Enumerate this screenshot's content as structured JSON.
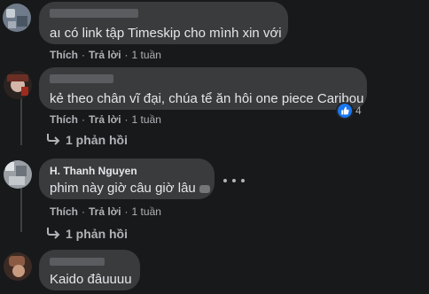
{
  "comments": [
    {
      "author": "",
      "text": "aı có link tập Timeskip cho mình xin với",
      "actions": {
        "like": "Thích",
        "reply": "Trả lời",
        "time": "1 tuần"
      }
    },
    {
      "author": "",
      "text": "kẻ theo chân vĩ đại, chúa tể ăn hôi one piece Caribou",
      "actions": {
        "like": "Thích",
        "reply": "Trả lời",
        "time": "1 tuần"
      },
      "reactions": {
        "icon": "like-icon",
        "count": "4"
      },
      "replies_label": "1 phản hồi"
    },
    {
      "author": "H. Thanh Nguyen",
      "text": "phim này giờ câu giờ lâu",
      "actions": {
        "like": "Thích",
        "reply": "Trả lời",
        "time": "1 tuần"
      },
      "more_icon": "more-options-icon",
      "replies_label": "1 phản hồi"
    },
    {
      "author": "",
      "text": "Kaido đâuuuu"
    }
  ],
  "colors": {
    "background": "#18191a",
    "bubble": "#3a3b3c",
    "text": "#e4e6eb",
    "secondary": "#b0b3b8",
    "like_blue": "#1877f2"
  }
}
